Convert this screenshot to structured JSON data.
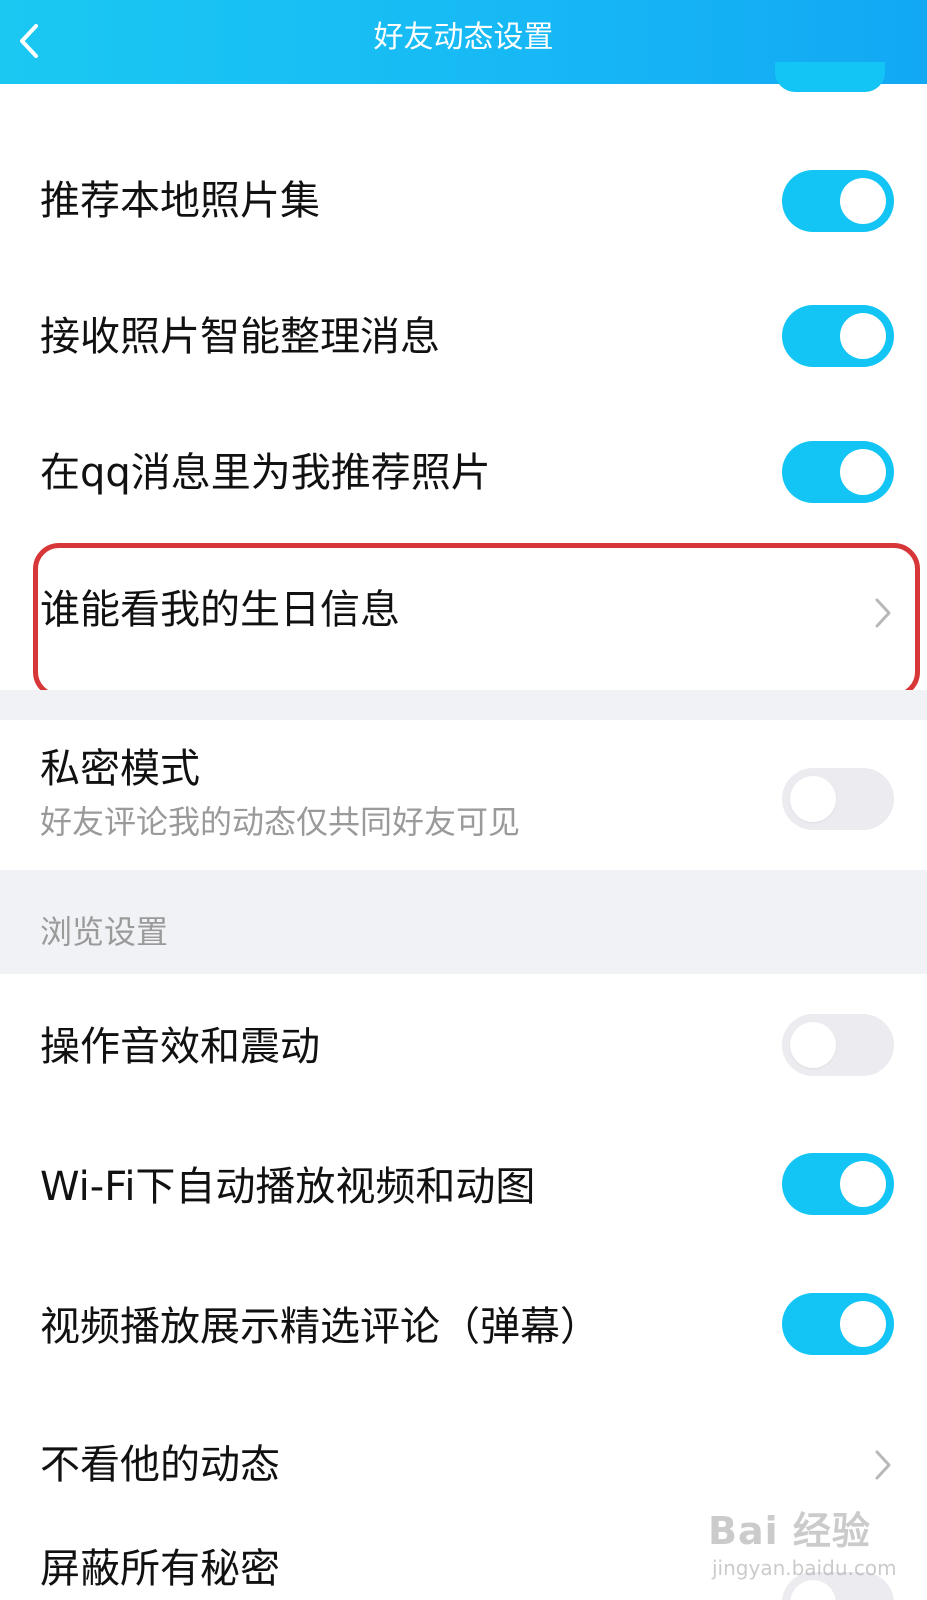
{
  "header": {
    "title": "好友动态设置",
    "accent": "#17b9f5"
  },
  "items": {
    "local_albums": {
      "label": "推荐本地照片集",
      "on": true
    },
    "smart_organize": {
      "label": "接收照片智能整理消息",
      "on": true
    },
    "qq_recommend": {
      "label": "在qq消息里为我推荐照片",
      "on": true
    },
    "birthday_visibility": {
      "label": "谁能看我的生日信息"
    },
    "private_mode": {
      "label": "私密模式",
      "desc": "好友评论我的动态仅共同好友可见",
      "on": false
    }
  },
  "browse_section": {
    "title": "浏览设置",
    "sound_vibration": {
      "label": "操作音效和震动",
      "on": false
    },
    "wifi_autoplay": {
      "label": "Wi-Fi下自动播放视频和动图",
      "on": true
    },
    "video_comments": {
      "label": "视频播放展示精选评论（弹幕）",
      "on": true
    },
    "hide_their_feed": {
      "label": "不看他的动态"
    },
    "hide_all_secrets": {
      "label": "屏蔽所有秘密"
    }
  },
  "colors": {
    "toggle_on": "#12c5f5",
    "toggle_off": "#ebebf0",
    "highlight_border": "#d8373a"
  },
  "watermark": {
    "logo": "Bai 经验",
    "sub": "jingyan.baidu.com"
  }
}
